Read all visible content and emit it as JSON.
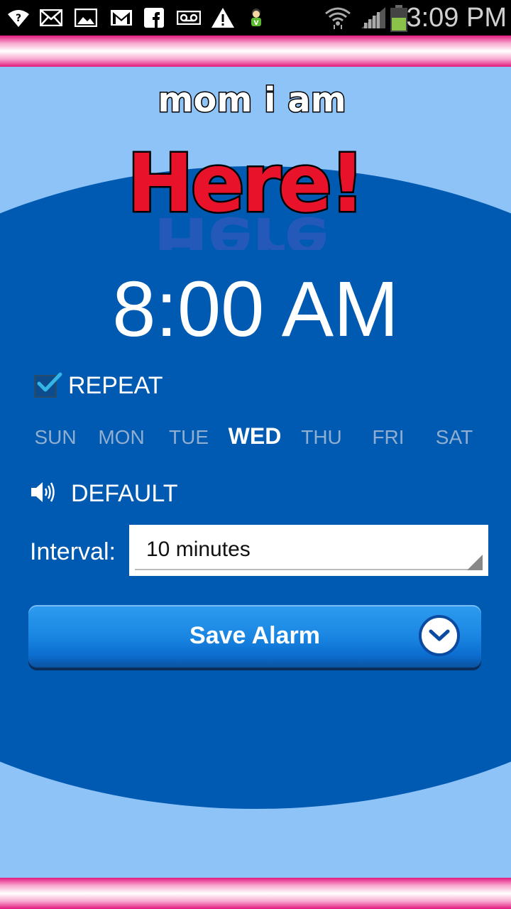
{
  "status_bar": {
    "time": "3:09 PM",
    "icons": [
      "wifi-question-icon",
      "mail-icon",
      "image-icon",
      "gmail-icon",
      "facebook-icon",
      "voicemail-icon",
      "warning-icon",
      "mascot-icon",
      "wifi-icon",
      "signal-icon",
      "battery-icon"
    ]
  },
  "logo": {
    "line1": "mom i am",
    "line2": "Here!"
  },
  "alarm": {
    "time": "8:00 AM",
    "repeat_label": "REPEAT",
    "repeat_checked": true,
    "days": [
      {
        "label": "SUN",
        "active": false
      },
      {
        "label": "MON",
        "active": false
      },
      {
        "label": "TUE",
        "active": false
      },
      {
        "label": "WED",
        "active": true
      },
      {
        "label": "THU",
        "active": false
      },
      {
        "label": "FRI",
        "active": false
      },
      {
        "label": "SAT",
        "active": false
      }
    ],
    "sound_label": "DEFAULT",
    "interval_label": "Interval:",
    "interval_value": "10 minutes",
    "save_label": "Save Alarm"
  },
  "colors": {
    "background": "#8dc3f7",
    "ellipse": "#005ab2",
    "stripe": "#e0197e",
    "button": "#1a86e2"
  }
}
